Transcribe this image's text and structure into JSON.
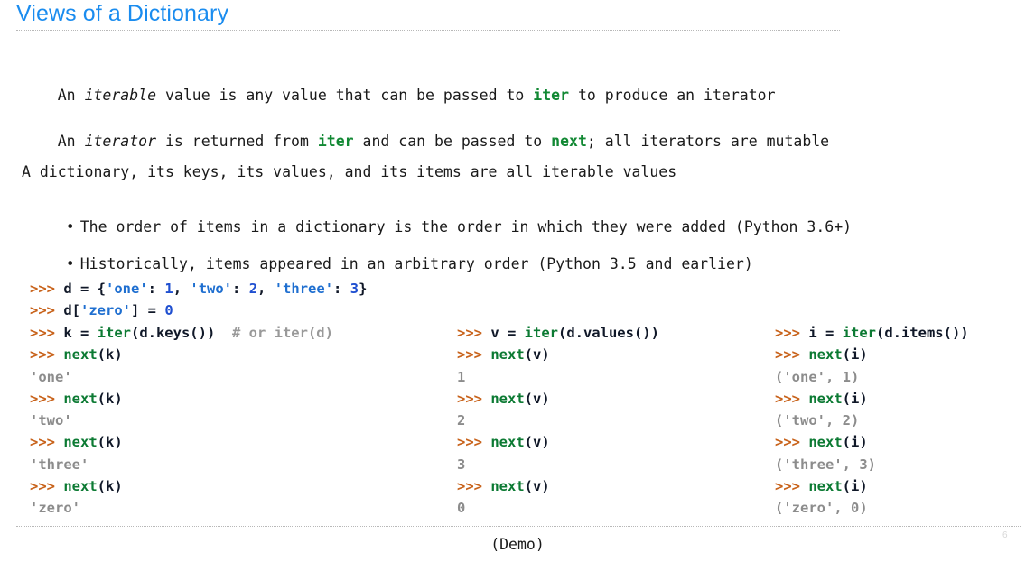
{
  "header": {
    "title": "Views of a Dictionary"
  },
  "body": {
    "paragraph_1": {
      "seg_1": "An ",
      "seg_2_italic": "iterable",
      "seg_3": " value is any value that can be passed to ",
      "seg_4_keyword": "iter",
      "seg_5": " to produce an iterator"
    },
    "paragraph_2": {
      "seg_1": "An ",
      "seg_2_italic": "iterator",
      "seg_3": " is returned from ",
      "seg_4_keyword": "iter",
      "seg_5": " and can be passed to ",
      "seg_6_keyword": "next",
      "seg_7": "; all iterators are mutable"
    },
    "paragraph_3": "A dictionary, its keys, its values, and its items are all iterable values",
    "bullets": [
      {
        "marker": "•",
        "text": "The order of items in a dictionary is the order in which they were added (Python 3.6+)"
      },
      {
        "marker": "•",
        "text": "Historically, items appeared in an arbitrary order (Python 3.5 and earlier)"
      }
    ]
  },
  "code": {
    "prompt": ">>>",
    "header_lines": [
      {
        "tokens": [
          {
            "t": ">>> ",
            "c": "pr"
          },
          {
            "t": "d = {",
            "c": "nm"
          },
          {
            "t": "'one'",
            "c": "st"
          },
          {
            "t": ": ",
            "c": "nm"
          },
          {
            "t": "1",
            "c": "nu"
          },
          {
            "t": ", ",
            "c": "nm"
          },
          {
            "t": "'two'",
            "c": "st"
          },
          {
            "t": ": ",
            "c": "nm"
          },
          {
            "t": "2",
            "c": "nu"
          },
          {
            "t": ", ",
            "c": "nm"
          },
          {
            "t": "'three'",
            "c": "st"
          },
          {
            "t": ": ",
            "c": "nm"
          },
          {
            "t": "3",
            "c": "nu"
          },
          {
            "t": "}",
            "c": "nm"
          }
        ]
      },
      {
        "tokens": [
          {
            "t": ">>> ",
            "c": "pr"
          },
          {
            "t": "d[",
            "c": "nm"
          },
          {
            "t": "'zero'",
            "c": "st"
          },
          {
            "t": "] = ",
            "c": "nm"
          },
          {
            "t": "0",
            "c": "nu"
          }
        ]
      }
    ],
    "column_keys": {
      "lines": [
        {
          "tokens": [
            {
              "t": ">>> ",
              "c": "pr"
            },
            {
              "t": "k = ",
              "c": "nm"
            },
            {
              "t": "iter",
              "c": "fn"
            },
            {
              "t": "(d.keys())",
              "c": "nm"
            },
            {
              "t": "  # or iter(d)",
              "c": "cm"
            }
          ]
        },
        {
          "tokens": [
            {
              "t": ">>> ",
              "c": "pr"
            },
            {
              "t": "next",
              "c": "fn"
            },
            {
              "t": "(k)",
              "c": "nm"
            }
          ]
        },
        {
          "tokens": [
            {
              "t": "'one'",
              "c": "out"
            }
          ]
        },
        {
          "tokens": [
            {
              "t": ">>> ",
              "c": "pr"
            },
            {
              "t": "next",
              "c": "fn"
            },
            {
              "t": "(k)",
              "c": "nm"
            }
          ]
        },
        {
          "tokens": [
            {
              "t": "'two'",
              "c": "out"
            }
          ]
        },
        {
          "tokens": [
            {
              "t": ">>> ",
              "c": "pr"
            },
            {
              "t": "next",
              "c": "fn"
            },
            {
              "t": "(k)",
              "c": "nm"
            }
          ]
        },
        {
          "tokens": [
            {
              "t": "'three'",
              "c": "out"
            }
          ]
        },
        {
          "tokens": [
            {
              "t": ">>> ",
              "c": "pr"
            },
            {
              "t": "next",
              "c": "fn"
            },
            {
              "t": "(k)",
              "c": "nm"
            }
          ]
        },
        {
          "tokens": [
            {
              "t": "'zero'",
              "c": "out"
            }
          ]
        }
      ]
    },
    "column_values": {
      "lines": [
        {
          "tokens": [
            {
              "t": ">>> ",
              "c": "pr"
            },
            {
              "t": "v = ",
              "c": "nm"
            },
            {
              "t": "iter",
              "c": "fn"
            },
            {
              "t": "(d.values())",
              "c": "nm"
            }
          ]
        },
        {
          "tokens": [
            {
              "t": ">>> ",
              "c": "pr"
            },
            {
              "t": "next",
              "c": "fn"
            },
            {
              "t": "(v)",
              "c": "nm"
            }
          ]
        },
        {
          "tokens": [
            {
              "t": "1",
              "c": "out"
            }
          ]
        },
        {
          "tokens": [
            {
              "t": ">>> ",
              "c": "pr"
            },
            {
              "t": "next",
              "c": "fn"
            },
            {
              "t": "(v)",
              "c": "nm"
            }
          ]
        },
        {
          "tokens": [
            {
              "t": "2",
              "c": "out"
            }
          ]
        },
        {
          "tokens": [
            {
              "t": ">>> ",
              "c": "pr"
            },
            {
              "t": "next",
              "c": "fn"
            },
            {
              "t": "(v)",
              "c": "nm"
            }
          ]
        },
        {
          "tokens": [
            {
              "t": "3",
              "c": "out"
            }
          ]
        },
        {
          "tokens": [
            {
              "t": ">>> ",
              "c": "pr"
            },
            {
              "t": "next",
              "c": "fn"
            },
            {
              "t": "(v)",
              "c": "nm"
            }
          ]
        },
        {
          "tokens": [
            {
              "t": "0",
              "c": "out"
            }
          ]
        }
      ]
    },
    "column_items": {
      "lines": [
        {
          "tokens": [
            {
              "t": ">>> ",
              "c": "pr"
            },
            {
              "t": "i = ",
              "c": "nm"
            },
            {
              "t": "iter",
              "c": "fn"
            },
            {
              "t": "(d.items())",
              "c": "nm"
            }
          ]
        },
        {
          "tokens": [
            {
              "t": ">>> ",
              "c": "pr"
            },
            {
              "t": "next",
              "c": "fn"
            },
            {
              "t": "(i)",
              "c": "nm"
            }
          ]
        },
        {
          "tokens": [
            {
              "t": "('one', 1)",
              "c": "out"
            }
          ]
        },
        {
          "tokens": [
            {
              "t": ">>> ",
              "c": "pr"
            },
            {
              "t": "next",
              "c": "fn"
            },
            {
              "t": "(i)",
              "c": "nm"
            }
          ]
        },
        {
          "tokens": [
            {
              "t": "('two', 2)",
              "c": "out"
            }
          ]
        },
        {
          "tokens": [
            {
              "t": ">>> ",
              "c": "pr"
            },
            {
              "t": "next",
              "c": "fn"
            },
            {
              "t": "(i)",
              "c": "nm"
            }
          ]
        },
        {
          "tokens": [
            {
              "t": "('three', 3)",
              "c": "out"
            }
          ]
        },
        {
          "tokens": [
            {
              "t": ">>> ",
              "c": "pr"
            },
            {
              "t": "next",
              "c": "fn"
            },
            {
              "t": "(i)",
              "c": "nm"
            }
          ]
        },
        {
          "tokens": [
            {
              "t": "('zero', 0)",
              "c": "out"
            }
          ]
        }
      ]
    }
  },
  "footer": {
    "caption": "(Demo)",
    "page_number": "6"
  },
  "colors": {
    "title": "#1a8cef",
    "prompt": "#c8621a",
    "builtin": "#0c7a33",
    "string": "#1f6fd0",
    "number": "#1f4fd0",
    "comment": "#999999",
    "output": "#8c8c8c",
    "text": "#1a1a1a",
    "rule": "#b8b8b8"
  }
}
